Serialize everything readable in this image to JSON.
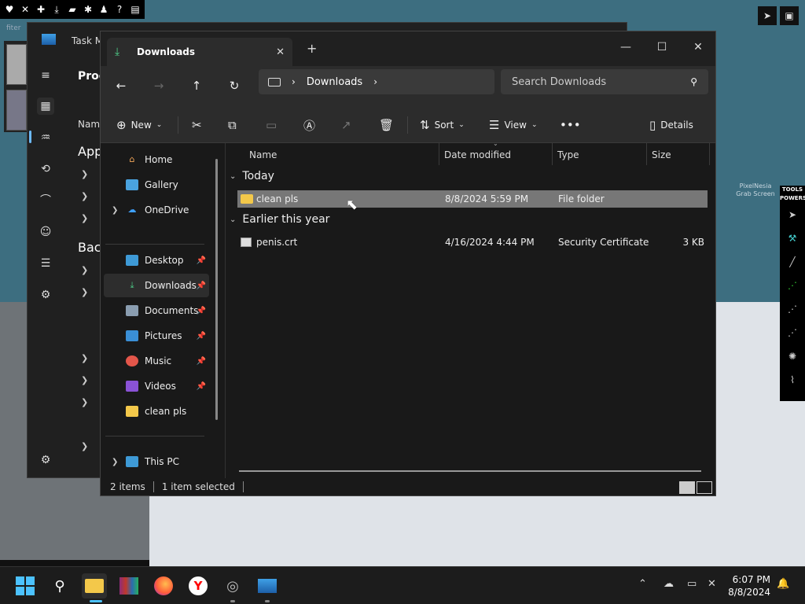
{
  "desktop": {
    "filter_label": "fiter",
    "overlay_text": "PixelNesia Grab Screen"
  },
  "top_toolbar": {
    "icons": [
      "♥",
      "✕",
      "✚",
      "⤓",
      "▰",
      "✱",
      "♟",
      "?",
      "▤"
    ]
  },
  "tools_panel": {
    "label1": "TOOLS",
    "label2": "POWERS"
  },
  "task_manager": {
    "title": "Task M",
    "processes_label": "Proc",
    "name_header": "Nam",
    "apps_label": "App",
    "background_label": "Back"
  },
  "explorer": {
    "tab_title": "Downloads",
    "address": {
      "segment": "Downloads"
    },
    "search": {
      "placeholder": "Search Downloads"
    },
    "command_bar": {
      "new": "New",
      "sort": "Sort",
      "view": "View",
      "details": "Details"
    },
    "nav": {
      "home": "Home",
      "gallery": "Gallery",
      "onedrive": "OneDrive",
      "desktop": "Desktop",
      "downloads": "Downloads",
      "documents": "Documents",
      "pictures": "Pictures",
      "music": "Music",
      "videos": "Videos",
      "clean": "clean pls",
      "thispc": "This PC"
    },
    "columns": {
      "name": "Name",
      "date": "Date modified",
      "type": "Type",
      "size": "Size"
    },
    "groups": {
      "today": {
        "label": "Today",
        "items": [
          {
            "name": "clean pls",
            "date": "8/8/2024 5:59 PM",
            "type": "File folder",
            "size": ""
          }
        ]
      },
      "earlier": {
        "label": "Earlier this year",
        "items": [
          {
            "name": "penis.crt",
            "date": "4/16/2024 4:44 PM",
            "type": "Security Certificate",
            "size": "3 KB"
          }
        ]
      }
    },
    "status": {
      "count": "2 items",
      "selected": "1 item selected"
    }
  },
  "taskbar": {
    "time": "6:07 PM",
    "date": "8/8/2024"
  },
  "colors": {
    "accent": "#4cc2ff",
    "folder": "#f3c84a",
    "selection": "#777777"
  }
}
